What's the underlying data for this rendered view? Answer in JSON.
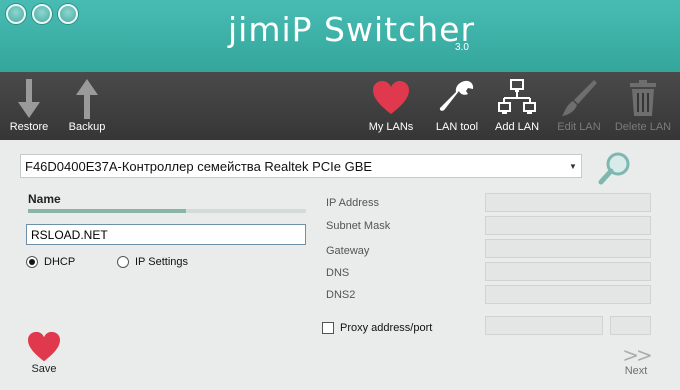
{
  "app": {
    "title": "jimiP Switcher",
    "version": "3.0"
  },
  "toolbar": {
    "restore": "Restore",
    "backup": "Backup",
    "my_lans": "My LANs",
    "lan_tool": "LAN tool",
    "add_lan": "Add LAN",
    "edit_lan": "Edit LAN",
    "delete_lan": "Delete LAN"
  },
  "adapter": {
    "selected": "F46D0400E37A-Контроллер семейства Realtek PCIe GBE"
  },
  "name": {
    "label": "Name",
    "value": "RSLOAD.NET"
  },
  "mode": {
    "dhcp": "DHCP",
    "ip_settings": "IP Settings",
    "selected": "DHCP"
  },
  "fields": {
    "ip_address": "IP Address",
    "subnet_mask": "Subnet Mask",
    "gateway": "Gateway",
    "dns": "DNS",
    "dns2": "DNS2"
  },
  "proxy": {
    "label": "Proxy address/port",
    "checked": false
  },
  "actions": {
    "save": "Save",
    "next": "Next",
    "next_symbol": ">>"
  },
  "colors": {
    "accent": "#3fb2a8",
    "heart": "#e0394d",
    "toolbar": "#3f3f3f"
  }
}
